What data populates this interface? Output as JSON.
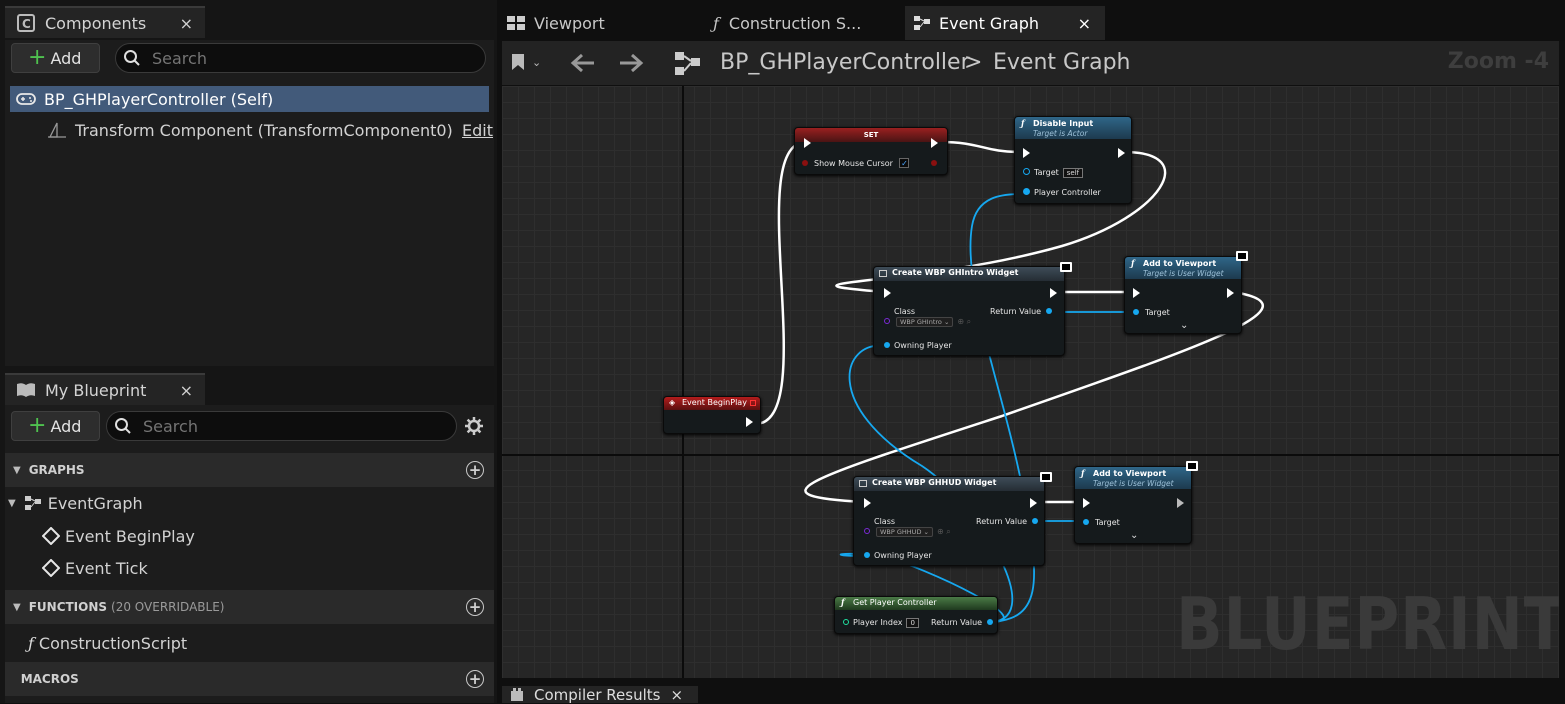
{
  "components_panel": {
    "tab_label": "Components",
    "close": "×",
    "add_label": "Add",
    "search_placeholder": "Search",
    "root_item": "BP_GHPlayerController (Self)",
    "child_item": "Transform Component (TransformComponent0)",
    "child_action": "Edit"
  },
  "my_blueprint": {
    "tab_label": "My Blueprint",
    "close": "×",
    "add_label": "Add",
    "search_placeholder": "Search",
    "graphs_header": "GRAPHS",
    "graph_name": "EventGraph",
    "events": [
      "Event BeginPlay",
      "Event Tick"
    ],
    "functions_header": "FUNCTIONS",
    "functions_sub": "(20 OVERRIDABLE)",
    "function_items": [
      "ConstructionScript"
    ],
    "macros_header": "MACROS"
  },
  "editor_tabs": [
    {
      "label": "Viewport",
      "icon": "viewport-grid-icon"
    },
    {
      "label": "Construction S...",
      "icon": "function-icon"
    },
    {
      "label": "Event Graph",
      "icon": "event-graph-icon",
      "close": "×"
    }
  ],
  "toolbar": {
    "breadcrumb_root": "BP_GHPlayerController",
    "breadcrumb_sep": ">",
    "breadcrumb_current": "Event Graph",
    "zoom": "Zoom -4"
  },
  "graph": {
    "watermark": "BLUEPRINT",
    "nodes": {
      "set": {
        "title": "SET",
        "pin": "Show Mouse Cursor",
        "check": "✓"
      },
      "disable_input": {
        "title": "Disable Input",
        "subtitle": "Target is Actor",
        "pin_target": "Target",
        "target_value": "self",
        "pin_pc": "Player Controller"
      },
      "create_intro": {
        "title": "Create WBP GHIntro Widget",
        "pin_class": "Class",
        "class_value": "WBP GHIntro",
        "pin_owner": "Owning Player",
        "pin_return": "Return Value"
      },
      "add_viewport_1": {
        "title": "Add to Viewport",
        "subtitle": "Target is User Widget",
        "pin_target": "Target"
      },
      "event_beginplay": {
        "title": "Event BeginPlay"
      },
      "create_hud": {
        "title": "Create WBP GHHUD Widget",
        "pin_class": "Class",
        "class_value": "WBP GHHUD",
        "pin_owner": "Owning Player",
        "pin_return": "Return Value"
      },
      "add_viewport_2": {
        "title": "Add to Viewport",
        "subtitle": "Target is User Widget",
        "pin_target": "Target"
      },
      "get_pc": {
        "title": "Get Player Controller",
        "pin_index": "Player Index",
        "index_value": "0",
        "pin_return": "Return Value"
      }
    }
  },
  "bottom_tab": {
    "label": "Compiler Results",
    "close": "×"
  },
  "colors": {
    "exec_wire": "#ffffff",
    "object_wire": "#16a8f0",
    "set_header": "#7a1c1c",
    "function_header": "#2e5a78",
    "event_header": "#8e1414",
    "pure_header": "#3d6a3a"
  }
}
